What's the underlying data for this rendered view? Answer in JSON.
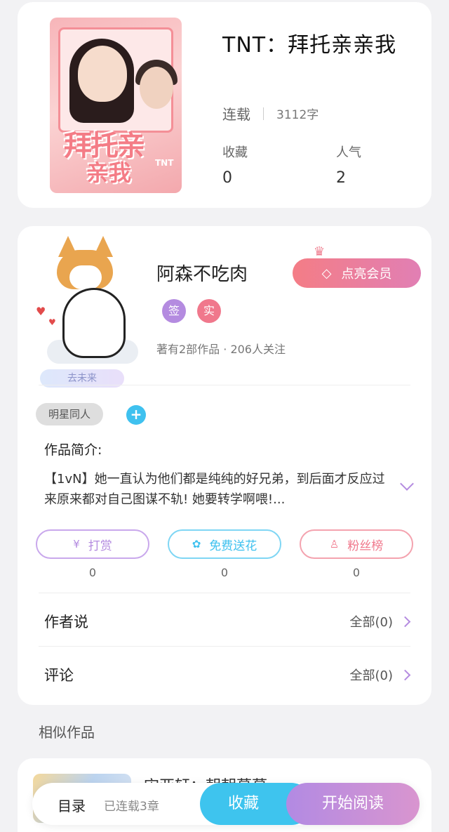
{
  "book": {
    "title": "TNT：拜托亲亲我",
    "status": "连载",
    "word_count": "3112字",
    "collect_label": "收藏",
    "collect_count": "0",
    "popularity_label": "人气",
    "popularity_count": "2",
    "cover_text_1": "拜托亲",
    "cover_text_2": "亲我",
    "cover_text_3": "TNT"
  },
  "author": {
    "name": "阿森不吃肉",
    "member_button": "点亮会员",
    "badge_signed": "签",
    "badge_verified": "实",
    "meta": "著有2部作品 · 206人关注",
    "avatar_tag": "去未来",
    "badge_colors": {
      "signed": "#b48be0",
      "verified": "#f0788c"
    }
  },
  "work": {
    "genre_tag": "明星同人",
    "intro_label": "作品简介:",
    "intro_text": "【1vN】她一直认为他们都是纯纯的好兄弟，到后面才反应过来原来都对自己图谋不轨! 她要转学啊喂!..."
  },
  "actions": [
    {
      "label": "打赏",
      "count": "0",
      "icon": "yen-coin-icon",
      "color": "#b48be0"
    },
    {
      "label": "免费送花",
      "count": "0",
      "icon": "flower-icon",
      "color": "#3fc1ef"
    },
    {
      "label": "粉丝榜",
      "count": "0",
      "icon": "fan-user-icon",
      "color": "#f0788c"
    }
  ],
  "author_says": {
    "title": "作者说",
    "link": "全部(0)"
  },
  "comments": {
    "title": "评论",
    "link": "全部(0)"
  },
  "similar": {
    "title": "相似作品",
    "first_item_title": "宋亚轩：朝朝暮暮"
  },
  "bottom_bar": {
    "toc": "目录",
    "chapters": "已连载3章",
    "collect": "收藏",
    "read": "开始阅读"
  }
}
